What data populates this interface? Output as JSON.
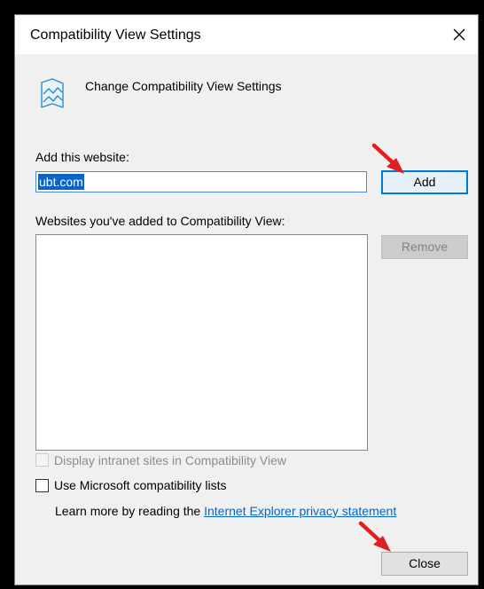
{
  "window": {
    "title": "Compatibility View Settings",
    "close_glyph": "✕"
  },
  "header": {
    "icon": "compatibility-view-icon",
    "text": "Change Compatibility View Settings"
  },
  "add_section": {
    "label": "Add this website:",
    "input_value": "ubt.com",
    "add_button": "Add"
  },
  "list_section": {
    "label": "Websites you've added to Compatibility View:",
    "items": [],
    "remove_button": "Remove"
  },
  "options": {
    "intranet_checkbox": {
      "label": "Display intranet sites in Compatibility View",
      "checked": false,
      "disabled": true
    },
    "microsoft_lists_checkbox": {
      "label": "Use Microsoft compatibility lists",
      "checked": false,
      "disabled": false
    }
  },
  "learn_more": {
    "prefix": "Learn more by reading the ",
    "link_text": "Internet Explorer privacy statement"
  },
  "footer": {
    "close_button": "Close"
  },
  "colors": {
    "annotation_arrow": "#e02020",
    "accent": "#0078d7",
    "selection": "#0a64c8",
    "link": "#0066cc"
  }
}
